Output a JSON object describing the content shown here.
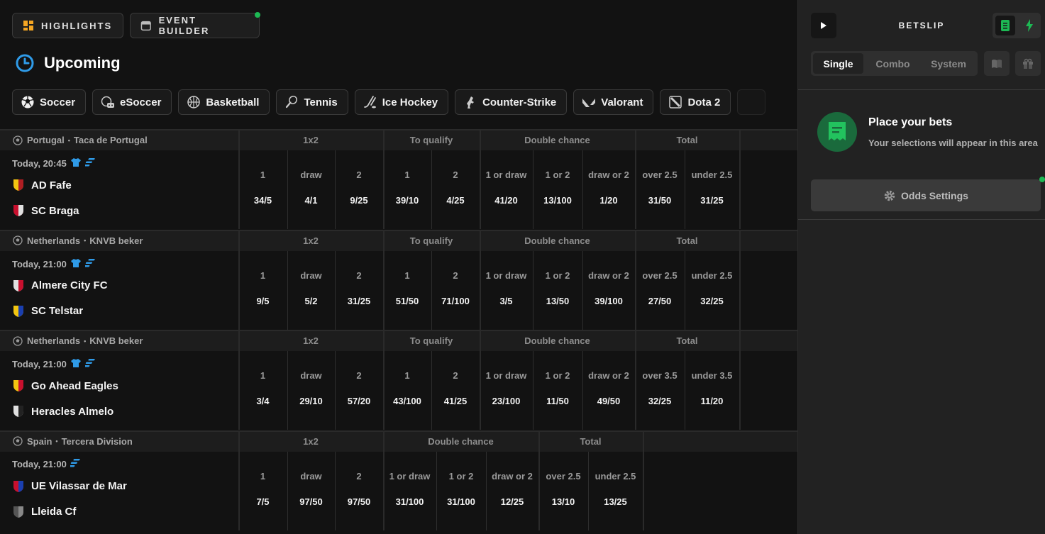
{
  "header": {
    "highlights": "HIGHLIGHTS",
    "event_builder": "EVENT BUILDER",
    "section_title": "Upcoming"
  },
  "sports": [
    {
      "label": "Soccer",
      "icon": "soccer-ball-icon"
    },
    {
      "label": "eSoccer",
      "icon": "esoccer-icon"
    },
    {
      "label": "Basketball",
      "icon": "basketball-icon"
    },
    {
      "label": "Tennis",
      "icon": "tennis-icon"
    },
    {
      "label": "Ice Hockey",
      "icon": "ice-hockey-icon"
    },
    {
      "label": "Counter-Strike",
      "icon": "counter-strike-icon"
    },
    {
      "label": "Valorant",
      "icon": "valorant-icon"
    },
    {
      "label": "Dota 2",
      "icon": "dota2-icon"
    }
  ],
  "events": [
    {
      "country": "Portugal",
      "league": "Taca de Portugal",
      "time": "Today, 20:45",
      "home": "AD Fafe",
      "away": "SC Braga",
      "markets": [
        {
          "name": "1x2",
          "selections": [
            {
              "label": "1",
              "odd": "34/5"
            },
            {
              "label": "draw",
              "odd": "4/1"
            },
            {
              "label": "2",
              "odd": "9/25"
            }
          ]
        },
        {
          "name": "To qualify",
          "selections": [
            {
              "label": "1",
              "odd": "39/10"
            },
            {
              "label": "2",
              "odd": "4/25"
            }
          ]
        },
        {
          "name": "Double chance",
          "selections": [
            {
              "label": "1 or draw",
              "odd": "41/20"
            },
            {
              "label": "1 or 2",
              "odd": "13/100"
            },
            {
              "label": "draw or 2",
              "odd": "1/20"
            }
          ]
        },
        {
          "name": "Total",
          "selections": [
            {
              "label": "over 2.5",
              "odd": "31/50"
            },
            {
              "label": "under 2.5",
              "odd": "31/25"
            }
          ]
        }
      ]
    },
    {
      "country": "Netherlands",
      "league": "KNVB beker",
      "time": "Today, 21:00",
      "home": "Almere City FC",
      "away": "SC Telstar",
      "markets": [
        {
          "name": "1x2",
          "selections": [
            {
              "label": "1",
              "odd": "9/5"
            },
            {
              "label": "draw",
              "odd": "5/2"
            },
            {
              "label": "2",
              "odd": "31/25"
            }
          ]
        },
        {
          "name": "To qualify",
          "selections": [
            {
              "label": "1",
              "odd": "51/50"
            },
            {
              "label": "2",
              "odd": "71/100"
            }
          ]
        },
        {
          "name": "Double chance",
          "selections": [
            {
              "label": "1 or draw",
              "odd": "3/5"
            },
            {
              "label": "1 or 2",
              "odd": "13/50"
            },
            {
              "label": "draw or 2",
              "odd": "39/100"
            }
          ]
        },
        {
          "name": "Total",
          "selections": [
            {
              "label": "over 2.5",
              "odd": "27/50"
            },
            {
              "label": "under 2.5",
              "odd": "32/25"
            }
          ]
        }
      ]
    },
    {
      "country": "Netherlands",
      "league": "KNVB beker",
      "time": "Today, 21:00",
      "home": "Go Ahead Eagles",
      "away": "Heracles Almelo",
      "markets": [
        {
          "name": "1x2",
          "selections": [
            {
              "label": "1",
              "odd": "3/4"
            },
            {
              "label": "draw",
              "odd": "29/10"
            },
            {
              "label": "2",
              "odd": "57/20"
            }
          ]
        },
        {
          "name": "To qualify",
          "selections": [
            {
              "label": "1",
              "odd": "43/100"
            },
            {
              "label": "2",
              "odd": "41/25"
            }
          ]
        },
        {
          "name": "Double chance",
          "selections": [
            {
              "label": "1 or draw",
              "odd": "23/100"
            },
            {
              "label": "1 or 2",
              "odd": "11/50"
            },
            {
              "label": "draw or 2",
              "odd": "49/50"
            }
          ]
        },
        {
          "name": "Total",
          "selections": [
            {
              "label": "over 3.5",
              "odd": "32/25"
            },
            {
              "label": "under 3.5",
              "odd": "11/20"
            }
          ]
        }
      ]
    },
    {
      "country": "Spain",
      "league": "Tercera Division",
      "time": "Today, 21:00",
      "home": "UE Vilassar de Mar",
      "away": "Lleida Cf",
      "markets": [
        {
          "name": "1x2",
          "selections": [
            {
              "label": "1",
              "odd": "7/5"
            },
            {
              "label": "draw",
              "odd": "97/50"
            },
            {
              "label": "2",
              "odd": "97/50"
            }
          ]
        },
        {
          "name": "Double chance",
          "selections": [
            {
              "label": "1 or draw",
              "odd": "31/100"
            },
            {
              "label": "1 or 2",
              "odd": "31/100"
            },
            {
              "label": "draw or 2",
              "odd": "12/25"
            }
          ]
        },
        {
          "name": "Total",
          "selections": [
            {
              "label": "over 2.5",
              "odd": "13/10"
            },
            {
              "label": "under 2.5",
              "odd": "13/25"
            }
          ]
        }
      ]
    }
  ],
  "betslip": {
    "title": "BETSLIP",
    "tabs": [
      "Single",
      "Combo",
      "System"
    ],
    "active_tab": "Single",
    "empty_title": "Place your bets",
    "empty_sub": "Your selections will appear in this area",
    "odds_settings": "Odds Settings"
  },
  "colors": {
    "accent_blue": "#2f9be8",
    "accent_green": "#1db954",
    "background": "#121212"
  }
}
